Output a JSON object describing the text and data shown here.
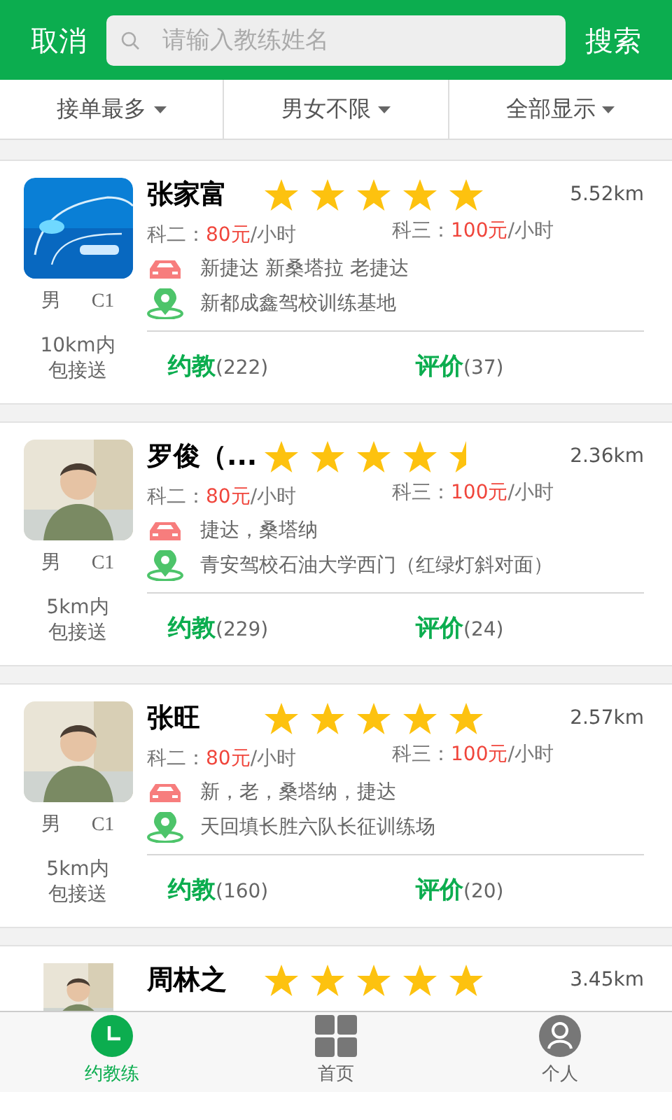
{
  "header": {
    "cancel": "取消",
    "search": {
      "placeholder": "请输入教练姓名"
    },
    "submit": "搜索"
  },
  "filters": [
    {
      "label": "接单最多"
    },
    {
      "label": "男女不限"
    },
    {
      "label": "全部显示"
    }
  ],
  "coaches": [
    {
      "name": "张家富",
      "stars": 5,
      "distance": "5.52km",
      "subject2": {
        "label": "科二：",
        "price": "80元",
        "unit": "/小时"
      },
      "subject3": {
        "label": "科三：",
        "price": "100元",
        "unit": "/小时"
      },
      "cars": "新捷达 新桑塔拉 老捷达",
      "place": "新都成鑫驾校训练基地",
      "gender": "男",
      "license": "C1",
      "pickup_range": "10km内",
      "pickup": "包接送",
      "book": "约教",
      "book_count": "(222)",
      "review": "评价",
      "review_count": "(37)"
    },
    {
      "name": "罗俊（...",
      "stars": 4.5,
      "distance": "2.36km",
      "subject2": {
        "label": "科二：",
        "price": "80元",
        "unit": "/小时"
      },
      "subject3": {
        "label": "科三：",
        "price": "100元",
        "unit": "/小时"
      },
      "cars": "捷达，桑塔纳",
      "place": "青安驾校石油大学西门（红绿灯斜对面）",
      "gender": "男",
      "license": "C1",
      "pickup_range": "5km内",
      "pickup": "包接送",
      "book": "约教",
      "book_count": "(229)",
      "review": "评价",
      "review_count": "(24)"
    },
    {
      "name": "张旺",
      "stars": 5,
      "distance": "2.57km",
      "subject2": {
        "label": "科二：",
        "price": "80元",
        "unit": "/小时"
      },
      "subject3": {
        "label": "科三：",
        "price": "100元",
        "unit": "/小时"
      },
      "cars": "新，老，桑塔纳，捷达",
      "place": "天回填长胜六队长征训练场",
      "gender": "男",
      "license": "C1",
      "pickup_range": "5km内",
      "pickup": "包接送",
      "book": "约教",
      "book_count": "(160)",
      "review": "评价",
      "review_count": "(20)"
    },
    {
      "name": "周林之",
      "stars": 5,
      "distance": "3.45km"
    }
  ],
  "tabs": [
    {
      "kind": "clock",
      "label": "约教练",
      "selected": true
    },
    {
      "kind": "grid",
      "label": "首页",
      "selected": false
    },
    {
      "kind": "person",
      "label": "个人",
      "selected": false
    }
  ]
}
